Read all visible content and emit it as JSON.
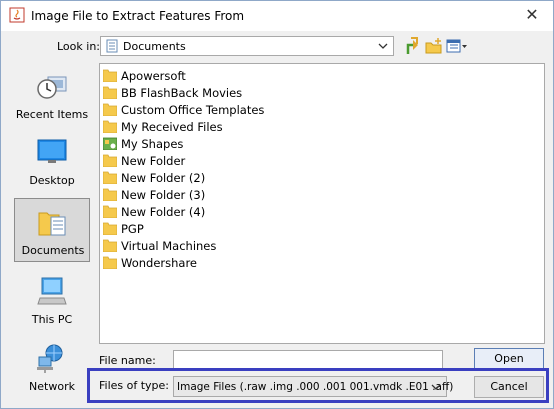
{
  "window": {
    "title": "Image File to Extract Features From",
    "close_label": "✕"
  },
  "lookin": {
    "label": "Look in:",
    "value": "Documents"
  },
  "places": [
    {
      "label": "Recent Items",
      "icon": "recent-items-icon",
      "selected": false
    },
    {
      "label": "Desktop",
      "icon": "desktop-icon",
      "selected": false
    },
    {
      "label": "Documents",
      "icon": "documents-icon",
      "selected": true
    },
    {
      "label": "This PC",
      "icon": "computer-icon",
      "selected": false
    },
    {
      "label": "Network",
      "icon": "network-icon",
      "selected": false
    }
  ],
  "files": [
    {
      "name": "Apowersoft",
      "icon": "folder-icon"
    },
    {
      "name": "BB FlashBack Movies",
      "icon": "folder-icon"
    },
    {
      "name": "Custom Office Templates",
      "icon": "folder-icon"
    },
    {
      "name": "My Received Files",
      "icon": "folder-icon"
    },
    {
      "name": "My Shapes",
      "icon": "shapes-folder-icon"
    },
    {
      "name": "New Folder",
      "icon": "folder-icon"
    },
    {
      "name": "New Folder (2)",
      "icon": "folder-icon"
    },
    {
      "name": "New Folder (3)",
      "icon": "folder-icon"
    },
    {
      "name": "New Folder (4)",
      "icon": "folder-icon"
    },
    {
      "name": "PGP",
      "icon": "folder-icon"
    },
    {
      "name": "Virtual Machines",
      "icon": "folder-icon"
    },
    {
      "name": "Wondershare",
      "icon": "folder-icon"
    }
  ],
  "filename": {
    "label": "File name:",
    "value": ""
  },
  "filetype": {
    "label": "Files of type:",
    "value": "Image Files (.raw .img .000 .001 001.vmdk .E01 .aff)"
  },
  "buttons": {
    "open": "Open",
    "cancel": "Cancel"
  },
  "colors": {
    "highlight_border": "#3a3fc0",
    "folder": "#f5c94c"
  }
}
